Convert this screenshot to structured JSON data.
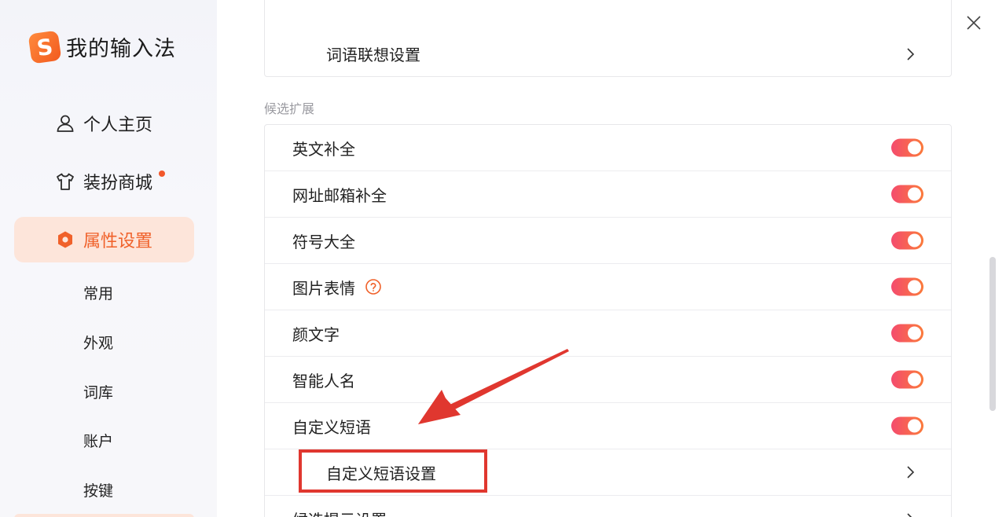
{
  "app": {
    "name": "我的输入法",
    "logo_letter": "S"
  },
  "sidebar": {
    "nav": [
      {
        "label": "个人主页",
        "icon": "user-icon"
      },
      {
        "label": "装扮商城",
        "icon": "tshirt-icon",
        "badge": true
      },
      {
        "label": "属性设置",
        "icon": "settings-hexagon-icon",
        "active": true
      }
    ],
    "sub_items": [
      "常用",
      "外观",
      "词库",
      "账户",
      "按键"
    ]
  },
  "window_controls": {
    "feedback_icon": "feedback-icon",
    "minimize_icon": "minimize-icon",
    "maximize_icon": "maximize-icon",
    "close_icon": "close-icon"
  },
  "main": {
    "top_card_row": "词语联想设置",
    "section_label": "候选扩展",
    "rows": [
      {
        "label": "英文补全",
        "toggle": true
      },
      {
        "label": "网址邮箱补全",
        "toggle": true
      },
      {
        "label": "符号大全",
        "toggle": true
      },
      {
        "label": "图片表情",
        "toggle": true,
        "help_icon": "question-circle-icon"
      },
      {
        "label": "颜文字",
        "toggle": true
      },
      {
        "label": "智能人名",
        "toggle": true
      },
      {
        "label": "自定义短语",
        "toggle": true
      }
    ],
    "sub_row": "自定义短语设置",
    "bottom_row": "候选提示设置"
  },
  "colors": {
    "accent": "#f0612a",
    "toggle_start": "#f44b6e",
    "toggle_end": "#fb7a3a",
    "annotation_red": "#e0372f"
  }
}
